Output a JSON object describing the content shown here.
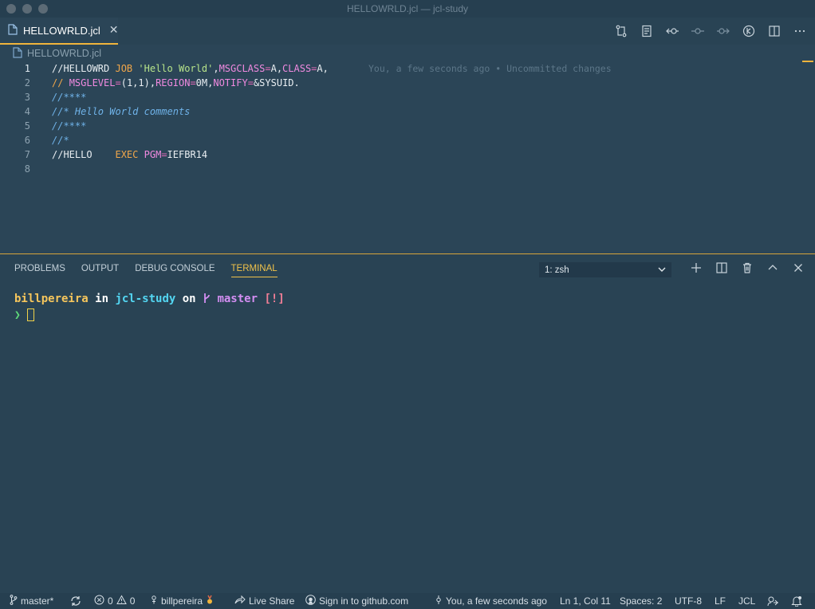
{
  "window": {
    "title": "HELLOWRLD.jcl — jcl-study"
  },
  "tab": {
    "label": "HELLOWRLD.jcl",
    "close": "✕"
  },
  "breadcrumb": {
    "file": "HELLOWRLD.jcl"
  },
  "editor": {
    "lines": [
      {
        "num": "1",
        "tokens": [
          [
            "plain",
            "//HELLOWRD "
          ],
          [
            "kw",
            "JOB"
          ],
          [
            "plain",
            " "
          ],
          [
            "str",
            "'Hello World'"
          ],
          [
            "plain",
            ","
          ],
          [
            "param",
            "MSGCLASS"
          ],
          [
            "eq",
            "="
          ],
          [
            "plain",
            "A,"
          ],
          [
            "param",
            "CLASS"
          ],
          [
            "eq",
            "="
          ],
          [
            "plain",
            "A,"
          ]
        ]
      },
      {
        "num": "2",
        "tokens": [
          [
            "kw",
            "//"
          ],
          [
            "plain",
            " "
          ],
          [
            "param",
            "MSGLEVEL"
          ],
          [
            "eq",
            "="
          ],
          [
            "plain",
            "(1,1),"
          ],
          [
            "param",
            "REGION"
          ],
          [
            "eq",
            "="
          ],
          [
            "plain",
            "0M,"
          ],
          [
            "param",
            "NOTIFY"
          ],
          [
            "eq",
            "="
          ],
          [
            "plain",
            "&SYSUID."
          ]
        ]
      },
      {
        "num": "3",
        "tokens": [
          [
            "comment",
            "//****"
          ]
        ]
      },
      {
        "num": "4",
        "tokens": [
          [
            "comment",
            "//* Hello World comments"
          ]
        ]
      },
      {
        "num": "5",
        "tokens": [
          [
            "comment",
            "//****"
          ]
        ]
      },
      {
        "num": "6",
        "tokens": [
          [
            "comment",
            "//*"
          ]
        ]
      },
      {
        "num": "7",
        "tokens": [
          [
            "plain",
            "//HELLO    "
          ],
          [
            "kw",
            "EXEC"
          ],
          [
            "plain",
            " "
          ],
          [
            "param",
            "PGM"
          ],
          [
            "eq",
            "="
          ],
          [
            "plain",
            "IEFBR14"
          ]
        ]
      },
      {
        "num": "8",
        "tokens": []
      }
    ],
    "blame": "You, a few seconds ago • Uncommitted changes"
  },
  "panel": {
    "tabs": [
      "PROBLEMS",
      "OUTPUT",
      "DEBUG CONSOLE",
      "TERMINAL"
    ],
    "active_tab": "TERMINAL",
    "terminal_select": "1: zsh"
  },
  "terminal": {
    "user": "billpereira",
    "in": " in ",
    "dir": "jcl-study",
    "on": " on ",
    "branch": " master",
    "status": " [!]",
    "prompt": "❯"
  },
  "statusbar": {
    "branch": "master*",
    "errors": "0",
    "warnings": "0",
    "account": "billpereira",
    "live_share": "Live Share",
    "github": "Sign in to github.com",
    "blame": "You, a few seconds ago",
    "position": "Ln 1, Col 11",
    "spaces": "Spaces: 2",
    "encoding": "UTF-8",
    "eol": "LF",
    "language": "JCL"
  },
  "colors": {
    "accent": "#f0b43c",
    "editor_bg": "#2b4557",
    "statusbar_bg": "#263f50"
  }
}
